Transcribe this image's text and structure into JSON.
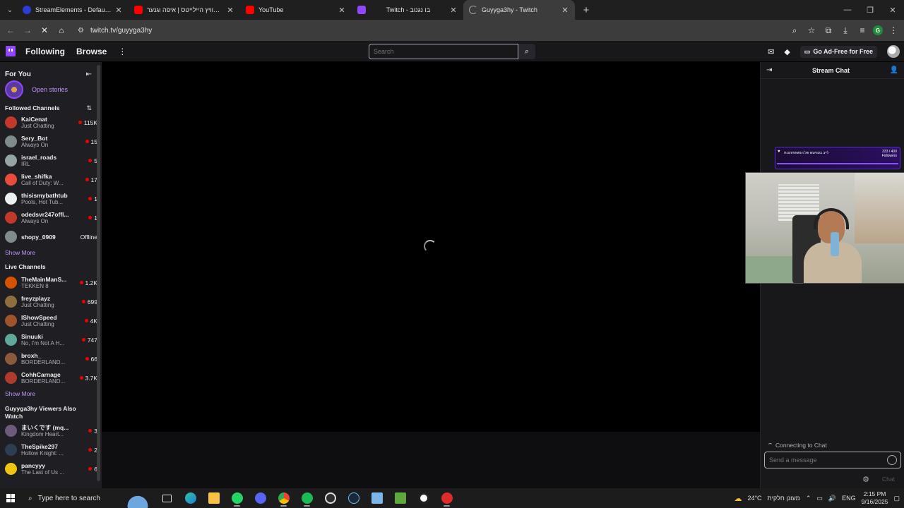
{
  "browser": {
    "tabs": [
      {
        "label": "StreamElements - Default comm",
        "favicon_color": "#2d3bd9",
        "active": false
      },
      {
        "label": "טוויץ היילייטס | איפה וגנער ...be",
        "favicon_color": "#ff0000",
        "active": false
      },
      {
        "label": "YouTube",
        "favicon_color": "#ff0000",
        "active": false
      },
      {
        "label": "Twitch - בו נגנוב",
        "favicon_color": "#9147ff",
        "active": false
      },
      {
        "label": "Guyyga3hy - Twitch",
        "favicon_color": "#9147ff",
        "active": true
      }
    ],
    "url": "twitch.tv/guyyga3hy",
    "profile_initial": "G"
  },
  "twitch_nav": {
    "following": "Following",
    "browse": "Browse",
    "more": "⋮",
    "search_placeholder": "Search",
    "ad_free": "Go Ad-Free for Free"
  },
  "sidebar": {
    "for_you": "For You",
    "open_stories": "Open stories",
    "followed_title": "Followed Channels",
    "followed": [
      {
        "name": "KaiCenat",
        "game": "Just Chatting",
        "viewers": "115K",
        "live": true,
        "color": "#c0392b"
      },
      {
        "name": "Sery_Bot",
        "game": "Always On",
        "viewers": "15",
        "live": true,
        "color": "#7f8c8d"
      },
      {
        "name": "israel_roads",
        "game": "IRL",
        "viewers": "5",
        "live": true,
        "color": "#95a5a6"
      },
      {
        "name": "live_shifka",
        "game": "Call of Duty: W...",
        "viewers": "17",
        "live": true,
        "color": "#e74c3c"
      },
      {
        "name": "thisismybathtub",
        "game": "Pools, Hot Tub...",
        "viewers": "1",
        "live": true,
        "color": "#ecf0f1"
      },
      {
        "name": "odedsvr247offl...",
        "game": "Always On",
        "viewers": "1",
        "live": true,
        "color": "#c0392b"
      },
      {
        "name": "shopy_0909",
        "game": "",
        "viewers": "Offline",
        "live": false,
        "color": "#7f8c8d"
      }
    ],
    "show_more": "Show More",
    "live_title": "Live Channels",
    "live": [
      {
        "name": "TheMainManS...",
        "game": "TEKKEN 8",
        "viewers": "1.2K",
        "color": "#d35400"
      },
      {
        "name": "freyzplayz",
        "game": "Just Chatting",
        "viewers": "699",
        "color": "#8e6e3e"
      },
      {
        "name": "IShowSpeed",
        "game": "Just Chatting",
        "viewers": "4K",
        "color": "#a0522d"
      },
      {
        "name": "Sinuuki",
        "game": "No, I'm Not A H...",
        "viewers": "747",
        "color": "#5fa89a"
      },
      {
        "name": "broxh_",
        "game": "BORDERLAND...",
        "viewers": "66",
        "color": "#8b5a3c"
      },
      {
        "name": "CohhCarnage",
        "game": "BORDERLAND...",
        "viewers": "3.7K",
        "color": "#b03a2e"
      }
    ],
    "show_more_2": "Show More",
    "also_watch_title": "Guyyga3hy Viewers Also Watch",
    "also_watch": [
      {
        "name": "まいくです (mq...",
        "game": "Kingdom Heart...",
        "viewers": "3",
        "color": "#6c5b7b"
      },
      {
        "name": "TheSpike297",
        "game": "Hollow Knight: ...",
        "viewers": "2",
        "color": "#2c3e50"
      },
      {
        "name": "pancyyy",
        "game": "The Last of Us ...",
        "viewers": "6",
        "color": "#f1c40f"
      }
    ]
  },
  "chat": {
    "title": "Stream Chat",
    "overlay_title": "לייב בטוויטש של המשפחתבות",
    "overlay_count": "333 / 400",
    "overlay_label": "Followers",
    "connecting": "Connecting to Chat",
    "input_placeholder": "Send a message",
    "chat_button": "Chat"
  },
  "taskbar": {
    "search_placeholder": "Type here to search",
    "weather": "24°C",
    "weather_text": "מעונן חלקית",
    "lang": "ENG",
    "time": "2:15 PM",
    "date": "9/16/2025"
  },
  "colors": {
    "twitch_purple": "#9147ff",
    "live_red": "#eb0400",
    "link_purple": "#bf94ff"
  }
}
